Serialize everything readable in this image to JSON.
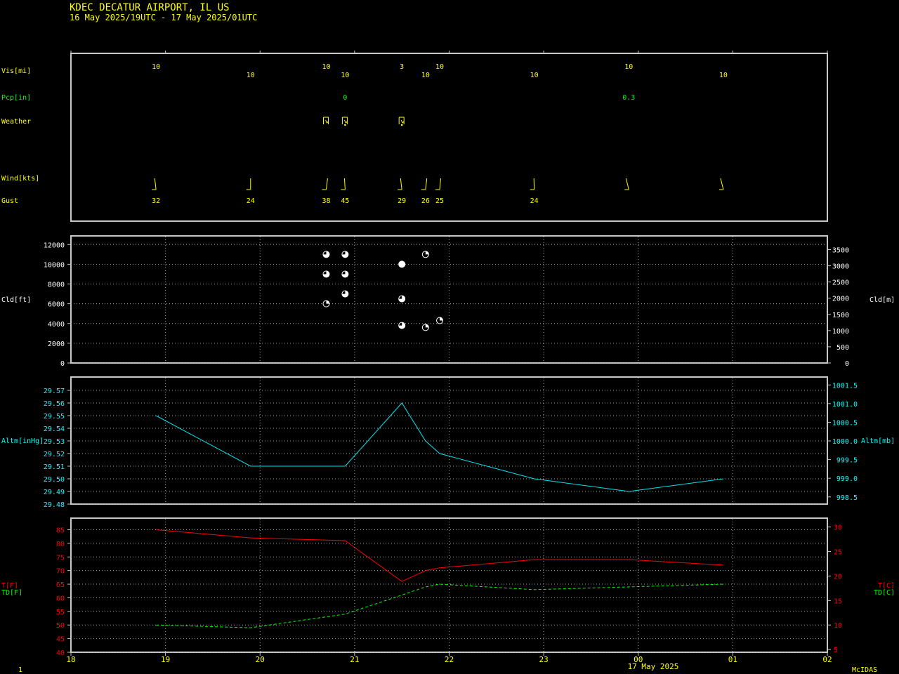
{
  "header": {
    "station": "KDEC  DECATUR AIRPORT, IL US",
    "period": "16 May 2025/19UTC - 17 May 2025/01UTC"
  },
  "footer": {
    "left_number": "1",
    "date_label": "17 May 2025",
    "brand": "McIDAS"
  },
  "colors": {
    "background": "#000000",
    "frame": "#c8c8c8",
    "grid": "#aaaaaa",
    "text_yellow": "#ffff00",
    "text_green": "#00ff00",
    "text_cyan": "#00ffff",
    "altimeter_line": "#00e5ee",
    "temperature_line": "#ff0000",
    "dewpoint_line": "#00ff00",
    "cloud_symbol": "#ffffff"
  },
  "time_axis": {
    "range_hours": [
      18,
      26
    ],
    "ticks": [
      {
        "h": 18,
        "label": "18"
      },
      {
        "h": 19,
        "label": "19"
      },
      {
        "h": 20,
        "label": "20"
      },
      {
        "h": 21,
        "label": "21"
      },
      {
        "h": 22,
        "label": "22"
      },
      {
        "h": 23,
        "label": "23"
      },
      {
        "h": 24,
        "label": "00"
      },
      {
        "h": 25,
        "label": "01"
      },
      {
        "h": 26,
        "label": "02"
      }
    ]
  },
  "obs_panel": {
    "labels": {
      "visibility": "Vis[mi]",
      "precip": "Pcp[in]",
      "weather": "Weather",
      "wind": "Wind[kts]",
      "gust": "Gust"
    },
    "visibility": [
      {
        "t": 18.9,
        "v": "10",
        "row": 0
      },
      {
        "t": 19.9,
        "v": "10",
        "row": 1
      },
      {
        "t": 20.7,
        "v": "10",
        "row": 0
      },
      {
        "t": 20.9,
        "v": "10",
        "row": 1
      },
      {
        "t": 21.5,
        "v": "3",
        "row": 0
      },
      {
        "t": 21.75,
        "v": "10",
        "row": 1
      },
      {
        "t": 21.9,
        "v": "10",
        "row": 0
      },
      {
        "t": 22.9,
        "v": "10",
        "row": 1
      },
      {
        "t": 23.9,
        "v": "10",
        "row": 0
      },
      {
        "t": 24.9,
        "v": "10",
        "row": 1
      }
    ],
    "precip": [
      {
        "t": 20.9,
        "v": "0"
      },
      {
        "t": 23.9,
        "v": "0.3"
      }
    ],
    "weather": [
      {
        "t": 20.7,
        "symbol": "thunderstorm"
      },
      {
        "t": 20.9,
        "symbol": "thunderstorm-rain"
      },
      {
        "t": 21.5,
        "symbol": "thunderstorm-rain"
      }
    ],
    "wind": [
      {
        "t": 18.9,
        "dir": 200
      },
      {
        "t": 19.9,
        "dir": 180
      },
      {
        "t": 20.7,
        "dir": 160
      },
      {
        "t": 20.9,
        "dir": 190
      },
      {
        "t": 21.5,
        "dir": 200
      },
      {
        "t": 21.75,
        "dir": 160
      },
      {
        "t": 21.9,
        "dir": 165
      },
      {
        "t": 22.9,
        "dir": 185
      },
      {
        "t": 23.9,
        "dir": 225
      },
      {
        "t": 24.9,
        "dir": 225
      }
    ],
    "gust": [
      {
        "t": 18.9,
        "v": "32"
      },
      {
        "t": 19.9,
        "v": "24"
      },
      {
        "t": 20.7,
        "v": "38"
      },
      {
        "t": 20.9,
        "v": "45"
      },
      {
        "t": 21.5,
        "v": "29"
      },
      {
        "t": 21.75,
        "v": "26"
      },
      {
        "t": 21.9,
        "v": "25"
      },
      {
        "t": 22.9,
        "v": "24"
      }
    ]
  },
  "chart_data": [
    {
      "type": "scatter",
      "ylabel_left": "Cld[ft]",
      "ylabel_right": "Cld[m]",
      "ylim": [
        0,
        12800
      ],
      "yticks_left": [
        "0",
        "2000",
        "4000",
        "6000",
        "8000",
        "10000",
        "12000"
      ],
      "yticks_right": [
        "0",
        "500",
        "1000",
        "1500",
        "2000",
        "2500",
        "3000",
        "3500"
      ],
      "grid": true,
      "points": [
        {
          "t": 20.7,
          "ft": 11000,
          "cover": "broken"
        },
        {
          "t": 20.9,
          "ft": 11000,
          "cover": "broken"
        },
        {
          "t": 20.7,
          "ft": 9000,
          "cover": "broken"
        },
        {
          "t": 20.9,
          "ft": 9000,
          "cover": "broken"
        },
        {
          "t": 20.9,
          "ft": 7000,
          "cover": "broken"
        },
        {
          "t": 20.7,
          "ft": 6000,
          "cover": "scattered"
        },
        {
          "t": 21.5,
          "ft": 10000,
          "cover": "overcast"
        },
        {
          "t": 21.5,
          "ft": 6500,
          "cover": "broken"
        },
        {
          "t": 21.5,
          "ft": 3800,
          "cover": "broken"
        },
        {
          "t": 21.75,
          "ft": 11000,
          "cover": "scattered"
        },
        {
          "t": 21.75,
          "ft": 3600,
          "cover": "scattered"
        },
        {
          "t": 21.9,
          "ft": 4300,
          "cover": "scattered"
        }
      ]
    },
    {
      "type": "line",
      "ylabel_left": "Altm[inHg]",
      "ylabel_right": "Altm[mb]",
      "ylim": [
        29.48,
        29.58
      ],
      "yticks_left": [
        "29.48",
        "29.49",
        "29.50",
        "29.51",
        "29.52",
        "29.53",
        "29.54",
        "29.55",
        "29.56",
        "29.57"
      ],
      "yticks_right": [
        "998.5",
        "999.0",
        "999.5",
        "1000.0",
        "1000.5",
        "1001.0",
        "1001.5"
      ],
      "grid": true,
      "series": [
        {
          "t": [
            18.9,
            19.9,
            20.9,
            21.5,
            21.75,
            21.9,
            22.9,
            23.9,
            24.9
          ],
          "values": [
            29.55,
            29.51,
            29.51,
            29.56,
            29.53,
            29.52,
            29.5,
            29.49,
            29.5
          ]
        }
      ]
    },
    {
      "type": "line",
      "ylabel_left_t": "T[F]",
      "ylabel_left_td": "TD[F]",
      "ylabel_right_t": "T[C]",
      "ylabel_right_td": "TD[C]",
      "ylim": [
        40,
        89
      ],
      "yticks_left": [
        "40",
        "45",
        "50",
        "55",
        "60",
        "65",
        "70",
        "75",
        "80",
        "85"
      ],
      "yticks_right": [
        "5",
        "10",
        "15",
        "20",
        "25",
        "30"
      ],
      "grid": true,
      "series": [
        {
          "key": "T",
          "t": [
            18.9,
            19.9,
            20.9,
            21.5,
            21.75,
            21.9,
            22.9,
            23.9,
            24.9
          ],
          "values": [
            85,
            82,
            81,
            66,
            70,
            71,
            74,
            74,
            72
          ]
        },
        {
          "key": "TD",
          "t": [
            18.9,
            19.9,
            20.9,
            21.5,
            21.75,
            21.9,
            22.9,
            23.9,
            24.9
          ],
          "values": [
            50,
            49,
            54,
            61,
            64,
            65,
            63,
            64,
            65
          ]
        }
      ]
    }
  ]
}
